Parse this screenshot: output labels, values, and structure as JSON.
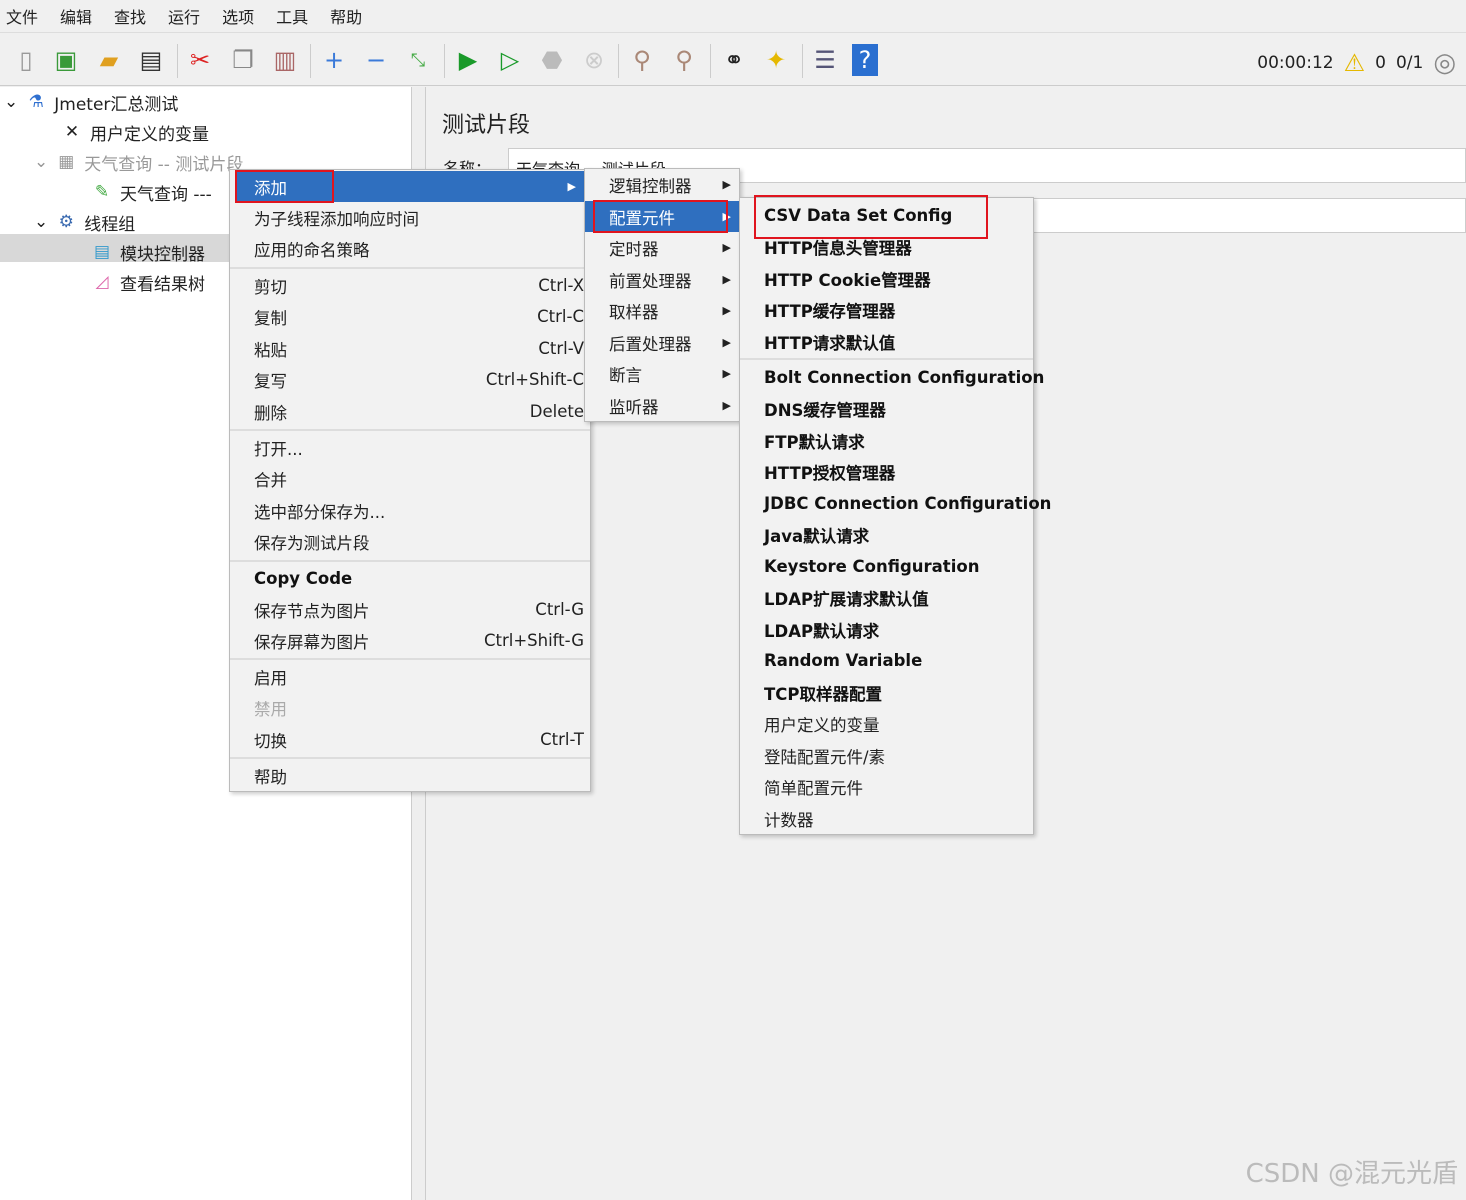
{
  "menubar": [
    "文件",
    "编辑",
    "查找",
    "运行",
    "选项",
    "工具",
    "帮助"
  ],
  "status": {
    "timer": "00:00:12",
    "warnings": "0",
    "threads": "0/1"
  },
  "tree": [
    {
      "label": "Jmeter汇总测试",
      "icon": "flask-icon"
    },
    {
      "label": "用户定义的变量",
      "icon": "wrench-icon"
    },
    {
      "label": "天气查询 -- 测试片段",
      "icon": "fragment-icon"
    },
    {
      "label": "天气查询 ---",
      "icon": "pipette-icon"
    },
    {
      "label": "线程组",
      "icon": "gear-icon"
    },
    {
      "label": "模块控制器",
      "icon": "module-icon"
    },
    {
      "label": "查看结果树",
      "icon": "chart-icon"
    }
  ],
  "panel": {
    "title": "测试片段",
    "name_label": "名称：",
    "name_value": "天气查询 -- 测试片段"
  },
  "context_menu": [
    {
      "label": "添加"
    },
    {
      "label": "为子线程添加响应时间"
    },
    {
      "label": "应用的命名策略"
    },
    {
      "label": "剪切",
      "shortcut": "Ctrl-X"
    },
    {
      "label": "复制",
      "shortcut": "Ctrl-C"
    },
    {
      "label": "粘贴",
      "shortcut": "Ctrl-V"
    },
    {
      "label": "复写",
      "shortcut": "Ctrl+Shift-C"
    },
    {
      "label": "删除",
      "shortcut": "Delete"
    },
    {
      "label": "打开..."
    },
    {
      "label": "合并"
    },
    {
      "label": "选中部分保存为..."
    },
    {
      "label": "保存为测试片段"
    },
    {
      "label": "Copy Code"
    },
    {
      "label": "保存节点为图片",
      "shortcut": "Ctrl-G"
    },
    {
      "label": "保存屏幕为图片",
      "shortcut": "Ctrl+Shift-G"
    },
    {
      "label": "启用"
    },
    {
      "label": "禁用"
    },
    {
      "label": "切换",
      "shortcut": "Ctrl-T"
    },
    {
      "label": "帮助"
    }
  ],
  "add_submenu": [
    "逻辑控制器",
    "配置元件",
    "定时器",
    "前置处理器",
    "取样器",
    "后置处理器",
    "断言",
    "监听器"
  ],
  "config_submenu": [
    "CSV Data Set Config",
    "HTTP信息头管理器",
    "HTTP Cookie管理器",
    "HTTP缓存管理器",
    "HTTP请求默认值",
    "Bolt Connection Configuration",
    "DNS缓存管理器",
    "FTP默认请求",
    "HTTP授权管理器",
    "JDBC Connection Configuration",
    "Java默认请求",
    "Keystore Configuration",
    "LDAP扩展请求默认值",
    "LDAP默认请求",
    "Random Variable",
    "TCP取样器配置",
    "用户定义的变量",
    "登陆配置元件/素",
    "简单配置元件",
    "计数器"
  ],
  "watermark": "CSDN @混元光盾",
  "colors": {
    "highlight": "#2f6fbf",
    "annotation": "#e0141e"
  }
}
